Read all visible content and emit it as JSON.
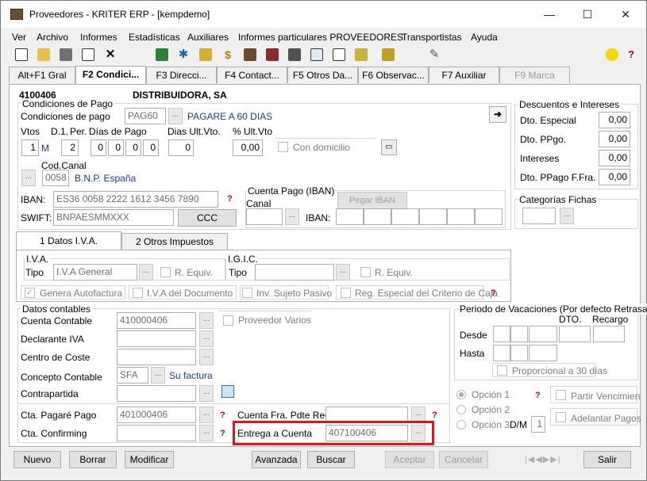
{
  "window": {
    "title": "Proveedores - KRITER ERP - [kempdemo]",
    "minimize": "—",
    "maximize": "☐",
    "close": "✕"
  },
  "menu": [
    "Ver",
    "Archivo",
    "Informes",
    "Estadísticas",
    "Auxiliares",
    "Informes particulares PROVEEDORES",
    "Transportistas",
    "Ayuda"
  ],
  "tabs": [
    "Alt+F1 Gral",
    "F2 Condici...",
    "F3 Direcci...",
    "F4 Contact...",
    "F5 Otros Da...",
    "F6 Observac...",
    "F7 Auxiliar",
    "F9 Marca"
  ],
  "record": {
    "code": "4100406",
    "name": "DISTRIBUIDORA, SA"
  },
  "condiciones_pago": {
    "legend": "Condiciones de Pago",
    "label": "Condiciones de pago",
    "code": "PAG60",
    "desc": "PAGARE A 60 DIAS",
    "vtos_label": "Vtos",
    "d1_label": "D.1.",
    "per_label": "Per.",
    "dias_label": "Días de Pago",
    "vtos": "1",
    "per": "M",
    "d1": "2",
    "dias": [
      "0",
      "0",
      "0",
      "0"
    ],
    "dias_ult_label": "Dias Ult.Vto.",
    "dias_ult": "0",
    "pct_ult_label": "% Ult.Vto",
    "pct_ult": "0,00",
    "con_domicilio": "Con domicilio",
    "cod_canal_label": "Cod.Canal",
    "cod_canal": "0058",
    "canal_desc": "B.N.P. España",
    "iban_label": "IBAN:",
    "iban": "ES36 0058 2222 1612 3456 7890",
    "swift_label": "SWIFT:",
    "swift": "BNPAESMMXXX",
    "ccc": "CCC"
  },
  "cuenta_pago": {
    "legend": "Cuenta Pago (IBAN)",
    "canal": "Canal",
    "iban": "IBAN:",
    "pegar": "Pegar IBAN"
  },
  "descuentos": {
    "legend": "Descuentos e Intereses",
    "rows": [
      {
        "label": "Dto. Especial",
        "value": "0,00"
      },
      {
        "label": "Dto. PPgo.",
        "value": "0,00"
      },
      {
        "label": "Intereses",
        "value": "0,00"
      },
      {
        "label": "Dto. PPago F.Fra.",
        "value": "0,00"
      }
    ]
  },
  "categorias": {
    "legend": "Categorías Fichas"
  },
  "subtabs": [
    "1 Datos I.V.A.",
    "2 Otros Impuestos"
  ],
  "iva": {
    "legend": "I.V.A.",
    "tipo": "Tipo",
    "value": "I.V.A General",
    "requiv": "R. Equiv."
  },
  "igic": {
    "legend": "I.G.I.C.",
    "tipo": "Tipo",
    "requiv": "R. Equiv."
  },
  "checks": [
    "Genera Autofactura",
    "I.V.A del Documento",
    "Inv. Sujeto Pasivo",
    "Reg. Especial del Criterio de Caja"
  ],
  "contables": {
    "legend": "Datos contables",
    "cuenta_label": "Cuenta Contable",
    "cuenta": "410000406",
    "prov_varios": "Proveedor Varios",
    "declarante": "Declarante IVA",
    "centro": "Centro de Coste",
    "concepto_label": "Concepto Contable",
    "concepto": "SFA",
    "concepto_desc": "Su factura",
    "contrapartida": "Contrapartida",
    "pagare_label": "Cta. Pagaré Pago",
    "pagare": "401000406",
    "confirming": "Cta. Confirming",
    "fra_pdte": "Cuenta Fra. Pdte Rec.",
    "entrega_label": "Entrega a Cuenta",
    "entrega": "407100406"
  },
  "vacaciones": {
    "legend": "Periodo de Vacaciones (Por defecto Retrasa)",
    "dto": "DTO.",
    "recargo": "Recargo",
    "desde": "Desde",
    "hasta": "Hasta",
    "proporcional": "Proporcional a 30 días",
    "opcion1": "Opción 1",
    "opcion2": "Opción 2",
    "opcion3": "Opción 3",
    "dm": "D/M",
    "dm_value": "1",
    "partir": "Partir Vencimien",
    "adelantar": "Adelantar Pagos"
  },
  "buttons": [
    "Nuevo",
    "Borrar",
    "Modificar",
    "Avanzada",
    "Buscar",
    "Aceptar",
    "Cancelar",
    "Salir"
  ],
  "colors": {
    "highlight": "#e0141c",
    "link": "#1a3aa0"
  }
}
